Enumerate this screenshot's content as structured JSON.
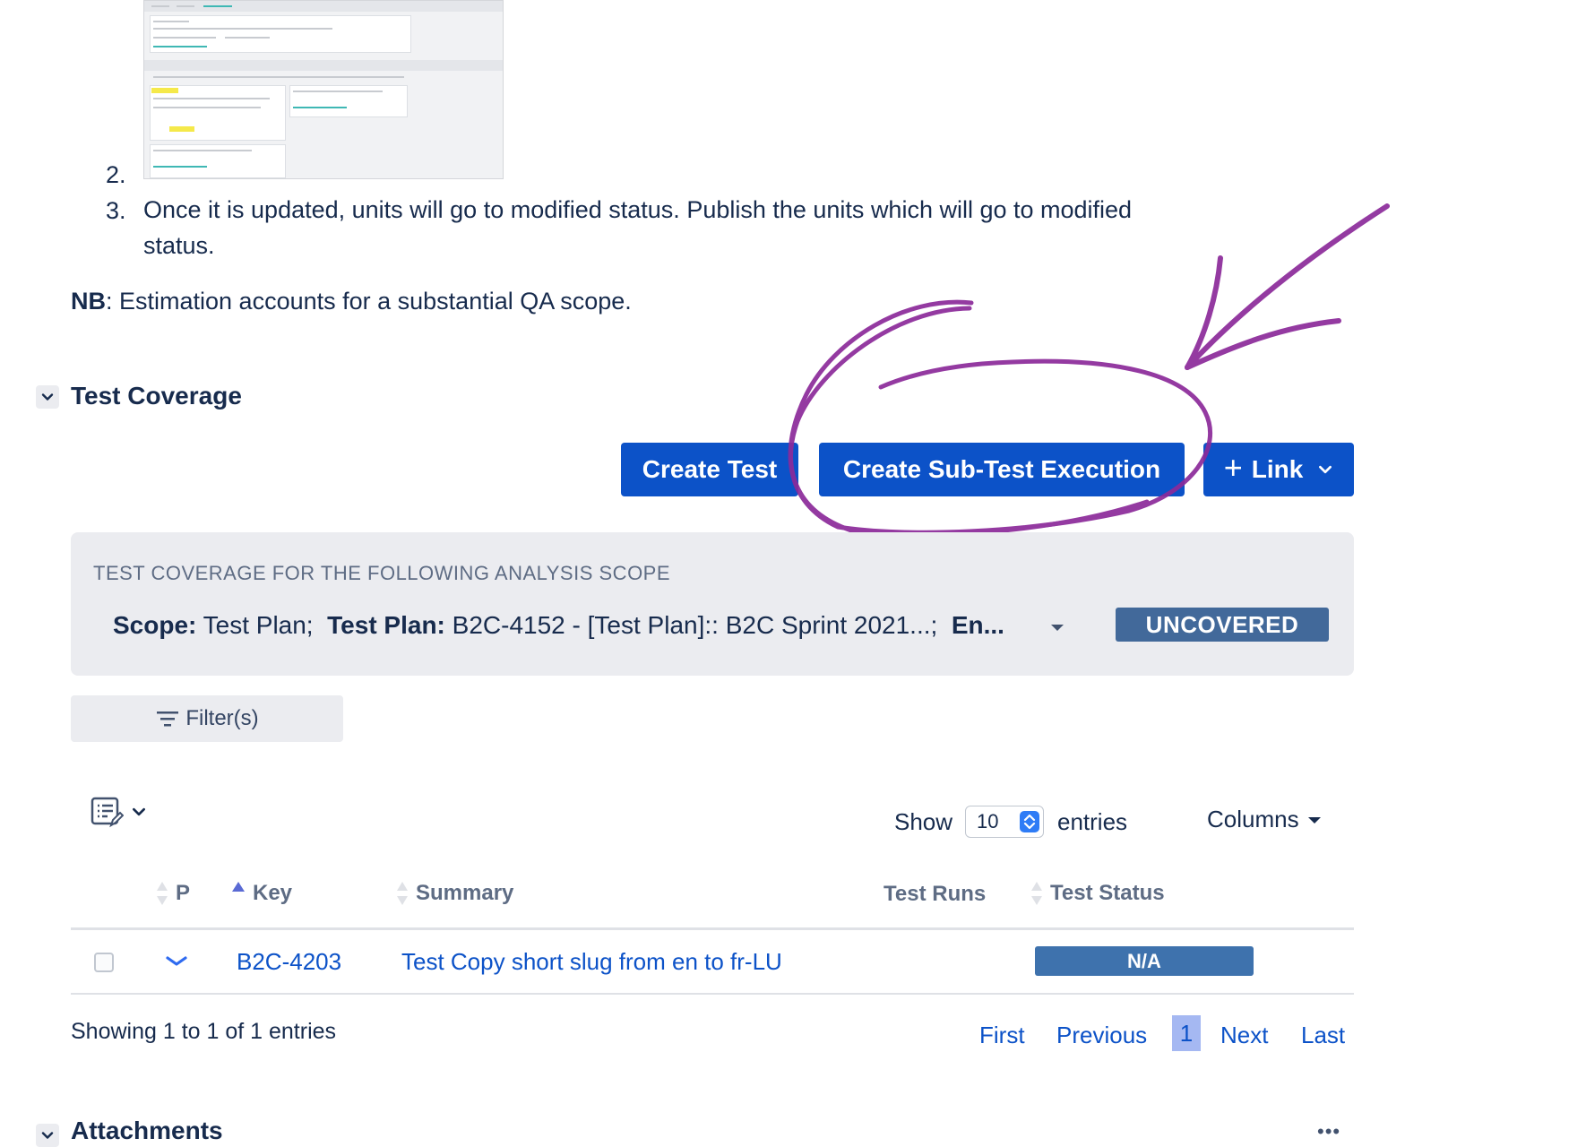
{
  "steps": {
    "item2_number": "2.",
    "item3_number": "3.",
    "item3_text_line1": "Once it is updated, units will go to modified status. Publish the units which will go to modified",
    "item3_text_line2": "status."
  },
  "note": {
    "label": "NB",
    "text": ": Estimation accounts for a substantial QA scope."
  },
  "test_coverage": {
    "title": "Test Coverage",
    "buttons": {
      "create_test": "Create Test",
      "create_sub_test_execution": "Create Sub-Test Execution",
      "link": "Link",
      "link_icon": "+"
    },
    "scope_panel": {
      "heading": "TEST COVERAGE FOR THE FOLLOWING ANALYSIS SCOPE",
      "scope_label": "Scope:",
      "scope_value": " Test Plan;",
      "test_plan_label": "Test Plan:",
      "test_plan_value": " B2C-4152 - [Test Plan]:: B2C Sprint 2021...;",
      "env_label": "En...",
      "status_badge": "UNCOVERED"
    },
    "filter_button": "Filter(s)",
    "table_controls": {
      "show_label": "Show",
      "entries_value": "10",
      "entries_label": "entries",
      "columns_button": "Columns"
    },
    "table": {
      "columns": [
        "P",
        "Key",
        "Summary",
        "Test Runs",
        "Test Status"
      ],
      "rows": [
        {
          "priority_icon": "chevron-down-icon",
          "key": "B2C-4203",
          "summary": "Test Copy short slug from en to fr-LU",
          "test_runs": "",
          "test_status": "N/A"
        }
      ]
    },
    "pagination": {
      "info": "Showing 1 to 1 of 1 entries",
      "first": "First",
      "previous": "Previous",
      "current_page": "1",
      "next": "Next",
      "last": "Last"
    }
  },
  "attachments": {
    "title": "Attachments",
    "more_icon": "•••"
  },
  "colors": {
    "primary_button": "#0c52c8",
    "annotation": "#8b2a9a",
    "uncovered_badge": "#42699a",
    "na_badge": "#3e72ad"
  }
}
